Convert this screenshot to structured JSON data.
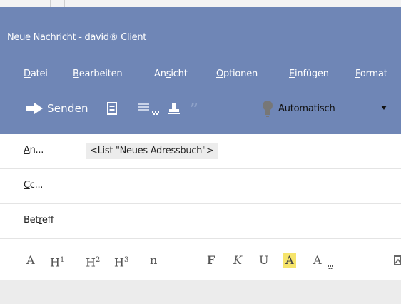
{
  "window": {
    "title": "Neue Nachricht - david® Client"
  },
  "menu": [
    {
      "id": "datei",
      "pre": "",
      "u": "D",
      "post": "atei"
    },
    {
      "id": "bearbeiten",
      "pre": "",
      "u": "B",
      "post": "earbeiten"
    },
    {
      "id": "ansicht",
      "pre": "An",
      "u": "s",
      "post": "icht"
    },
    {
      "id": "optionen",
      "pre": "",
      "u": "O",
      "post": "ptionen"
    },
    {
      "id": "einfuegen",
      "pre": "",
      "u": "E",
      "post": "infügen"
    },
    {
      "id": "format",
      "pre": "",
      "u": "F",
      "post": "ormat"
    }
  ],
  "toolbar": {
    "send_label": "Senden",
    "priority_label": "Automatisch"
  },
  "fields": {
    "to": {
      "label_u": "A",
      "label_post": "n...",
      "chip": "<List \"Neues Adressbuch\">"
    },
    "cc": {
      "label_u": "C",
      "label_post": "c..."
    },
    "subject": {
      "label_pre": "Bet",
      "label_u": "r",
      "label_post": "eff"
    }
  },
  "format_toolbar": {
    "font": "A",
    "h": "H",
    "h1_sup": "1",
    "h2_sup": "2",
    "h3_sup": "3",
    "normal": "n",
    "bold": "F",
    "italic": "K",
    "underline": "U",
    "highlight": "A",
    "font_color": "A"
  }
}
